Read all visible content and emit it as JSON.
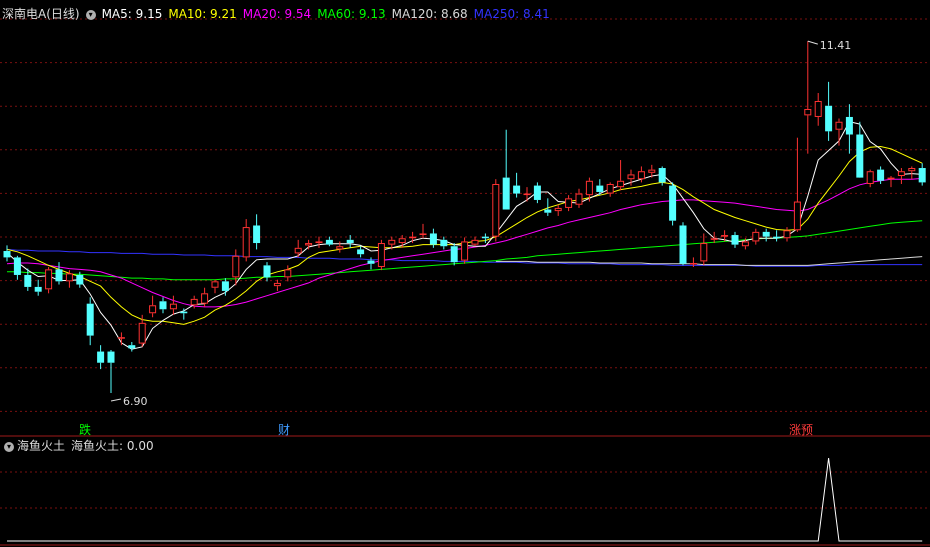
{
  "header": {
    "stock_name": "深南电A(日线)",
    "ma": [
      {
        "label": "MA5: 9.15",
        "color": "#ffffff"
      },
      {
        "label": "MA10: 9.21",
        "color": "#ffff00"
      },
      {
        "label": "MA20: 9.54",
        "color": "#ff00ff"
      },
      {
        "label": "MA60: 9.13",
        "color": "#00ff00"
      },
      {
        "label": "MA120: 8.68",
        "color": "#d8d8d8"
      },
      {
        "label": "MA250: 8.41",
        "color": "#3333ff"
      }
    ]
  },
  "price_panel": {
    "high_annotation": "11.41",
    "low_annotation": "6.90",
    "markers": [
      {
        "text": "跌",
        "color": "#00ff00"
      },
      {
        "text": "财",
        "color": "#3f9bff"
      },
      {
        "text": "涨预",
        "color": "#ff3b3b"
      }
    ]
  },
  "indicator_panel": {
    "name": "海鱼火土",
    "value_text": "海鱼火土: 0.00"
  },
  "chart_data": {
    "type": "candlestick",
    "ylim": [
      6.75,
      11.65
    ],
    "candles": [
      [
        8.78,
        8.85,
        8.65,
        8.7
      ],
      [
        8.7,
        8.72,
        8.42,
        8.48
      ],
      [
        8.48,
        8.56,
        8.28,
        8.33
      ],
      [
        8.33,
        8.42,
        8.22,
        8.27
      ],
      [
        8.3,
        8.58,
        8.25,
        8.55
      ],
      [
        8.55,
        8.64,
        8.36,
        8.4
      ],
      [
        8.4,
        8.54,
        8.32,
        8.5
      ],
      [
        8.48,
        8.52,
        8.32,
        8.36
      ],
      [
        8.12,
        8.2,
        7.6,
        7.72
      ],
      [
        7.52,
        7.6,
        7.3,
        7.38
      ],
      [
        7.52,
        7.54,
        7.0,
        7.38
      ],
      [
        7.7,
        7.76,
        7.6,
        7.7
      ],
      [
        7.6,
        7.64,
        7.52,
        7.56
      ],
      [
        7.62,
        7.98,
        7.58,
        7.88
      ],
      [
        8.0,
        8.22,
        7.95,
        8.1
      ],
      [
        8.15,
        8.2,
        8.0,
        8.05
      ],
      [
        8.05,
        8.22,
        7.98,
        8.12
      ],
      [
        8.02,
        8.06,
        7.92,
        8.0
      ],
      [
        8.1,
        8.22,
        8.06,
        8.18
      ],
      [
        8.12,
        8.32,
        8.08,
        8.25
      ],
      [
        8.32,
        8.42,
        8.25,
        8.4
      ],
      [
        8.4,
        8.44,
        8.22,
        8.28
      ],
      [
        8.45,
        8.8,
        8.35,
        8.72
      ],
      [
        8.7,
        9.18,
        8.65,
        9.08
      ],
      [
        9.1,
        9.24,
        8.8,
        8.88
      ],
      [
        8.6,
        8.64,
        8.4,
        8.45
      ],
      [
        8.34,
        8.42,
        8.28,
        8.38
      ],
      [
        8.45,
        8.6,
        8.4,
        8.55
      ],
      [
        8.75,
        8.92,
        8.7,
        8.82
      ],
      [
        8.85,
        8.92,
        8.8,
        8.88
      ],
      [
        8.88,
        8.96,
        8.82,
        8.9
      ],
      [
        8.92,
        8.96,
        8.84,
        8.86
      ],
      [
        8.8,
        8.9,
        8.76,
        8.84
      ],
      [
        8.92,
        8.98,
        8.82,
        8.88
      ],
      [
        8.8,
        8.84,
        8.7,
        8.74
      ],
      [
        8.66,
        8.7,
        8.55,
        8.62
      ],
      [
        8.58,
        8.92,
        8.54,
        8.88
      ],
      [
        8.86,
        8.96,
        8.8,
        8.92
      ],
      [
        8.88,
        8.98,
        8.82,
        8.94
      ],
      [
        8.94,
        9.02,
        8.88,
        8.96
      ],
      [
        8.98,
        9.12,
        8.94,
        9.0
      ],
      [
        9.0,
        9.06,
        8.82,
        8.86
      ],
      [
        8.92,
        8.96,
        8.8,
        8.84
      ],
      [
        8.84,
        8.88,
        8.6,
        8.64
      ],
      [
        8.66,
        8.95,
        8.62,
        8.9
      ],
      [
        8.86,
        8.96,
        8.84,
        8.92
      ],
      [
        8.96,
        9.0,
        8.88,
        8.94
      ],
      [
        8.96,
        9.68,
        8.9,
        9.62
      ],
      [
        9.7,
        10.3,
        9.5,
        9.3
      ],
      [
        9.6,
        9.76,
        9.45,
        9.5
      ],
      [
        9.5,
        9.58,
        9.4,
        9.5
      ],
      [
        9.6,
        9.64,
        9.38,
        9.42
      ],
      [
        9.3,
        9.44,
        9.22,
        9.26
      ],
      [
        9.28,
        9.36,
        9.22,
        9.32
      ],
      [
        9.32,
        9.48,
        9.28,
        9.44
      ],
      [
        9.36,
        9.56,
        9.32,
        9.5
      ],
      [
        9.48,
        9.7,
        9.4,
        9.66
      ],
      [
        9.6,
        9.68,
        9.48,
        9.52
      ],
      [
        9.5,
        9.64,
        9.46,
        9.62
      ],
      [
        9.58,
        9.92,
        9.54,
        9.66
      ],
      [
        9.68,
        9.8,
        9.6,
        9.74
      ],
      [
        9.68,
        9.84,
        9.64,
        9.78
      ],
      [
        9.76,
        9.86,
        9.7,
        9.8
      ],
      [
        9.82,
        9.84,
        9.6,
        9.64
      ],
      [
        9.6,
        9.64,
        9.1,
        9.16
      ],
      [
        9.1,
        9.14,
        8.6,
        8.62
      ],
      [
        8.62,
        8.7,
        8.58,
        8.63
      ],
      [
        8.65,
        9.0,
        8.6,
        8.88
      ],
      [
        8.92,
        9.02,
        8.88,
        8.94
      ],
      [
        8.96,
        9.04,
        8.9,
        8.98
      ],
      [
        8.98,
        9.02,
        8.82,
        8.86
      ],
      [
        8.84,
        8.94,
        8.8,
        8.9
      ],
      [
        8.9,
        9.06,
        8.86,
        9.02
      ],
      [
        9.02,
        9.06,
        8.9,
        8.96
      ],
      [
        8.96,
        9.04,
        8.9,
        8.94
      ],
      [
        8.94,
        9.08,
        8.9,
        9.04
      ],
      [
        9.04,
        10.2,
        9.02,
        9.4
      ],
      [
        10.48,
        11.41,
        10.0,
        10.56
      ],
      [
        10.46,
        10.76,
        10.35,
        10.66
      ],
      [
        10.6,
        10.9,
        10.16,
        10.28
      ],
      [
        10.3,
        10.44,
        10.1,
        10.4
      ],
      [
        10.46,
        10.62,
        10.0,
        10.24
      ],
      [
        10.24,
        10.4,
        9.9,
        9.7
      ],
      [
        9.62,
        9.8,
        9.58,
        9.78
      ],
      [
        9.8,
        9.84,
        9.62,
        9.66
      ],
      [
        9.68,
        9.72,
        9.58,
        9.7
      ],
      [
        9.72,
        9.82,
        9.62,
        9.78
      ],
      [
        9.78,
        9.84,
        9.68,
        9.82
      ],
      [
        9.82,
        9.88,
        9.6,
        9.64
      ]
    ],
    "ma5": [
      8.76,
      8.64,
      8.54,
      8.46,
      8.47,
      8.41,
      8.41,
      8.42,
      8.24,
      8.01,
      7.85,
      7.63,
      7.55,
      7.58,
      7.81,
      7.91,
      7.99,
      8.03,
      8.11,
      8.12,
      8.2,
      8.26,
      8.37,
      8.55,
      8.67,
      8.68,
      8.68,
      8.68,
      8.72,
      8.83,
      8.86,
      8.87,
      8.87,
      8.87,
      8.85,
      8.78,
      8.79,
      8.82,
      8.85,
      8.91,
      8.94,
      8.93,
      8.91,
      8.86,
      8.85,
      8.84,
      8.84,
      9.0,
      9.17,
      9.34,
      9.42,
      9.52,
      9.52,
      9.4,
      9.39,
      9.38,
      9.44,
      9.5,
      9.56,
      9.6,
      9.64,
      9.68,
      9.72,
      9.74,
      9.62,
      9.44,
      9.26,
      9.06,
      8.94,
      8.92,
      8.89,
      8.91,
      8.94,
      8.94,
      8.94,
      8.97,
      9.06,
      9.47,
      9.92,
      10.04,
      10.16,
      10.4,
      10.37,
      10.15,
      10.06,
      9.88,
      9.74,
      9.75,
      9.74
    ],
    "ma10": [
      8.8,
      8.77,
      8.72,
      8.66,
      8.6,
      8.55,
      8.5,
      8.46,
      8.4,
      8.34,
      8.2,
      8.08,
      7.98,
      7.92,
      7.9,
      7.9,
      7.88,
      7.86,
      7.9,
      7.95,
      8.04,
      8.1,
      8.18,
      8.28,
      8.4,
      8.48,
      8.52,
      8.55,
      8.6,
      8.7,
      8.76,
      8.78,
      8.8,
      8.82,
      8.84,
      8.83,
      8.82,
      8.82,
      8.83,
      8.84,
      8.86,
      8.86,
      8.86,
      8.86,
      8.88,
      8.9,
      8.91,
      8.96,
      9.04,
      9.12,
      9.2,
      9.27,
      9.32,
      9.36,
      9.4,
      9.42,
      9.45,
      9.48,
      9.51,
      9.55,
      9.57,
      9.59,
      9.62,
      9.64,
      9.62,
      9.55,
      9.46,
      9.38,
      9.3,
      9.25,
      9.2,
      9.16,
      9.12,
      9.08,
      9.05,
      9.04,
      9.05,
      9.18,
      9.38,
      9.55,
      9.72,
      9.9,
      10.02,
      10.08,
      10.09,
      10.06,
      10.0,
      9.94,
      9.88
    ],
    "ma20": [
      8.62,
      8.63,
      8.63,
      8.62,
      8.6,
      8.58,
      8.56,
      8.55,
      8.54,
      8.52,
      8.48,
      8.44,
      8.38,
      8.32,
      8.26,
      8.21,
      8.16,
      8.12,
      8.09,
      8.08,
      8.08,
      8.09,
      8.11,
      8.14,
      8.18,
      8.22,
      8.26,
      8.3,
      8.34,
      8.38,
      8.44,
      8.48,
      8.52,
      8.56,
      8.6,
      8.63,
      8.66,
      8.68,
      8.7,
      8.72,
      8.74,
      8.76,
      8.78,
      8.8,
      8.81,
      8.83,
      8.85,
      8.88,
      8.91,
      8.95,
      8.99,
      9.03,
      9.07,
      9.1,
      9.14,
      9.17,
      9.2,
      9.23,
      9.26,
      9.3,
      9.33,
      9.36,
      9.38,
      9.4,
      9.41,
      9.42,
      9.42,
      9.41,
      9.4,
      9.39,
      9.38,
      9.36,
      9.34,
      9.32,
      9.3,
      9.29,
      9.28,
      9.3,
      9.36,
      9.42,
      9.49,
      9.56,
      9.61,
      9.64,
      9.66,
      9.68,
      9.68,
      9.68,
      9.69
    ],
    "ma60": [
      8.52,
      8.52,
      8.51,
      8.51,
      8.5,
      8.5,
      8.49,
      8.49,
      8.48,
      8.47,
      8.46,
      8.45,
      8.44,
      8.44,
      8.43,
      8.43,
      8.42,
      8.42,
      8.42,
      8.42,
      8.42,
      8.43,
      8.43,
      8.44,
      8.45,
      8.45,
      8.46,
      8.46,
      8.47,
      8.48,
      8.49,
      8.5,
      8.51,
      8.52,
      8.53,
      8.54,
      8.55,
      8.56,
      8.57,
      8.58,
      8.59,
      8.6,
      8.61,
      8.62,
      8.63,
      8.64,
      8.65,
      8.66,
      8.68,
      8.69,
      8.7,
      8.72,
      8.73,
      8.74,
      8.75,
      8.76,
      8.77,
      8.78,
      8.79,
      8.8,
      8.81,
      8.82,
      8.83,
      8.84,
      8.85,
      8.86,
      8.87,
      8.88,
      8.89,
      8.9,
      8.91,
      8.92,
      8.93,
      8.94,
      8.94,
      8.95,
      8.96,
      8.97,
      8.99,
      9.01,
      9.03,
      9.05,
      9.07,
      9.09,
      9.11,
      9.13,
      9.14,
      9.15,
      9.16
    ],
    "ma120": [
      null,
      null,
      null,
      null,
      null,
      null,
      null,
      null,
      null,
      null,
      null,
      null,
      null,
      null,
      null,
      null,
      null,
      null,
      null,
      null,
      null,
      null,
      null,
      null,
      null,
      null,
      null,
      null,
      null,
      null,
      null,
      null,
      null,
      null,
      null,
      null,
      null,
      null,
      null,
      null,
      null,
      null,
      null,
      null,
      null,
      null,
      null,
      8.65,
      8.65,
      8.65,
      8.65,
      8.64,
      8.64,
      8.64,
      8.64,
      8.64,
      8.64,
      8.63,
      8.63,
      8.63,
      8.63,
      8.63,
      8.62,
      8.62,
      8.62,
      8.62,
      8.62,
      8.61,
      8.61,
      8.61,
      8.61,
      8.6,
      8.6,
      8.6,
      8.6,
      8.6,
      8.6,
      8.6,
      8.61,
      8.62,
      8.63,
      8.64,
      8.65,
      8.66,
      8.67,
      8.68,
      8.69,
      8.7,
      8.71
    ],
    "ma250": [
      8.8,
      8.79,
      8.79,
      8.78,
      8.78,
      8.78,
      8.77,
      8.77,
      8.76,
      8.76,
      8.76,
      8.75,
      8.75,
      8.75,
      8.74,
      8.74,
      8.74,
      8.73,
      8.73,
      8.73,
      8.72,
      8.72,
      8.72,
      8.71,
      8.71,
      8.71,
      8.7,
      8.7,
      8.7,
      8.69,
      8.69,
      8.69,
      8.68,
      8.68,
      8.68,
      8.67,
      8.67,
      8.67,
      8.66,
      8.66,
      8.66,
      8.66,
      8.65,
      8.65,
      8.65,
      8.65,
      8.64,
      8.64,
      8.64,
      8.64,
      8.63,
      8.63,
      8.63,
      8.63,
      8.62,
      8.62,
      8.62,
      8.62,
      8.62,
      8.61,
      8.61,
      8.61,
      8.61,
      8.61,
      8.6,
      8.6,
      8.6,
      8.6,
      8.6,
      8.6,
      8.6,
      8.6,
      8.59,
      8.59,
      8.59,
      8.59,
      8.59,
      8.59,
      8.6,
      8.6,
      8.6,
      8.61,
      8.61,
      8.61,
      8.61,
      8.61,
      8.61,
      8.61,
      8.61
    ],
    "indicator": {
      "name": "海鱼火土",
      "ylim": [
        0,
        1.05
      ],
      "values": [
        0,
        0,
        0,
        0,
        0,
        0,
        0,
        0,
        0,
        0,
        0,
        0,
        0,
        0,
        0,
        0,
        0,
        0,
        0,
        0,
        0,
        0,
        0,
        0,
        0,
        0,
        0,
        0,
        0,
        0,
        0,
        0,
        0,
        0,
        0,
        0,
        0,
        0,
        0,
        0,
        0,
        0,
        0,
        0,
        0,
        0,
        0,
        0,
        0,
        0,
        0,
        0,
        0,
        0,
        0,
        0,
        0,
        0,
        0,
        0,
        0,
        0,
        0,
        0,
        0,
        0,
        0,
        0,
        0,
        0,
        0,
        0,
        0,
        0,
        0,
        0,
        0,
        0,
        0,
        1,
        0,
        0,
        0,
        0,
        0,
        0,
        0,
        0,
        0
      ]
    }
  }
}
